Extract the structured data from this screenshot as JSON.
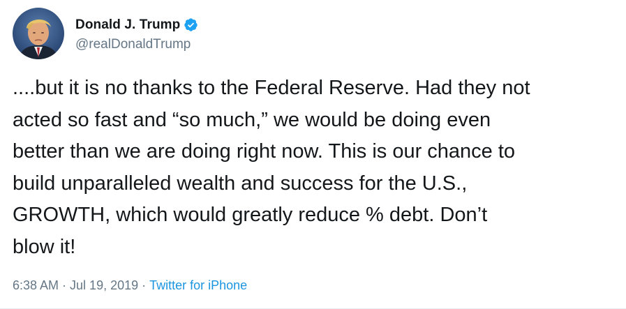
{
  "author": {
    "display_name": "Donald J. Trump",
    "handle": "@realDonaldTrump",
    "verified": true,
    "avatar_icon": "profile-photo",
    "verified_icon": "verified-badge-icon"
  },
  "tweet": {
    "lines": [
      "....but it is no thanks to the Federal Reserve. Had they not",
      "acted so fast and “so much,” we would be doing even",
      "better than we are doing right now. This is our chance to",
      "build unparalleled wealth and success for the U.S.,",
      "GROWTH, which would greatly reduce % debt. Don’t",
      "blow it!"
    ]
  },
  "meta": {
    "time": "6:38 AM",
    "separator": "·",
    "date": "Jul 19, 2019",
    "source": "Twitter for iPhone"
  },
  "colors": {
    "text": "#14171a",
    "secondary": "#657786",
    "link": "#1b95e0",
    "verified": "#1da1f2"
  }
}
